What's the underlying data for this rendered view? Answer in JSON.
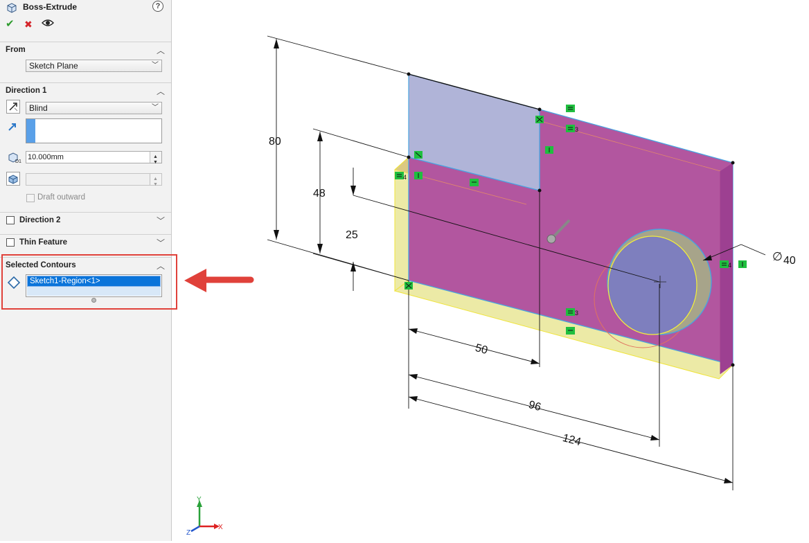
{
  "panel": {
    "title": "Boss-Extrude",
    "help": "?",
    "actions": {
      "ok": "✔",
      "cancel": "✖",
      "preview": "👁"
    },
    "from": {
      "header": "From",
      "value": "Sketch Plane"
    },
    "direction1": {
      "header": "Direction 1",
      "end_condition": "Blind",
      "depth": "10.000mm",
      "draft_label": "Draft outward"
    },
    "direction2": {
      "header": "Direction 2"
    },
    "thin_feature": {
      "header": "Thin Feature"
    },
    "selected_contours": {
      "header": "Selected Contours",
      "item": "Sketch1-Region<1>"
    }
  },
  "viewport": {
    "dimensions": {
      "height_total": "80",
      "height_mid": "48",
      "height_low": "25",
      "width_step": "50",
      "hole_x": "96",
      "width_total": "124",
      "hole_diameter": "40",
      "diameter_symbol": "∅"
    },
    "triad": {
      "x": "X",
      "y": "Y",
      "z": "Z"
    },
    "relation_marks": {
      "m3": "3",
      "m4": "4"
    }
  },
  "colors": {
    "face_magenta": "#b2569f",
    "face_blue": "#b0b4d8",
    "preview_yellow": "#efeeb0",
    "hole_blue": "#7e7fbe",
    "arrow_red": "#e0413a",
    "relation_green": "#1fbf3f"
  }
}
